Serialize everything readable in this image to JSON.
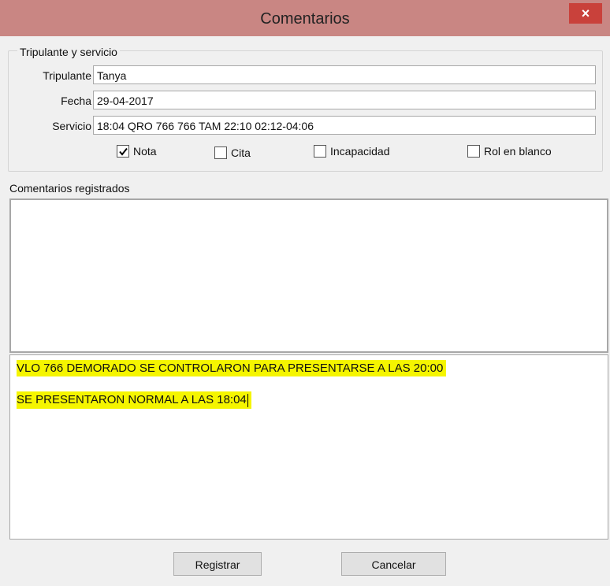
{
  "window": {
    "title": "Comentarios",
    "close_symbol": "×"
  },
  "group": {
    "legend": "Tripulante y servicio",
    "tripulante_label": "Tripulante",
    "tripulante_value": "Tanya",
    "fecha_label": "Fecha",
    "fecha_value": "29-04-2017",
    "servicio_label": "Servicio",
    "servicio_value": "18:04 QRO 766 766 TAM 22:10 02:12-04:06",
    "checkboxes": [
      {
        "label": "Nota",
        "checked": true
      },
      {
        "label": "Cita",
        "checked": false
      },
      {
        "label": "Incapacidad",
        "checked": false
      },
      {
        "label": "Rol en blanco",
        "checked": false
      }
    ]
  },
  "comments": {
    "label": "Comentarios registrados",
    "memo_lines": [
      "VLO 766 DEMORADO SE CONTROLARON PARA PRESENTARSE A LAS 20:00",
      "SE PRESENTARON NORMAL A LAS 18:04"
    ],
    "highlight_color": "#f5f500"
  },
  "buttons": {
    "register_label": "Registrar",
    "cancel_label": "Cancelar"
  }
}
